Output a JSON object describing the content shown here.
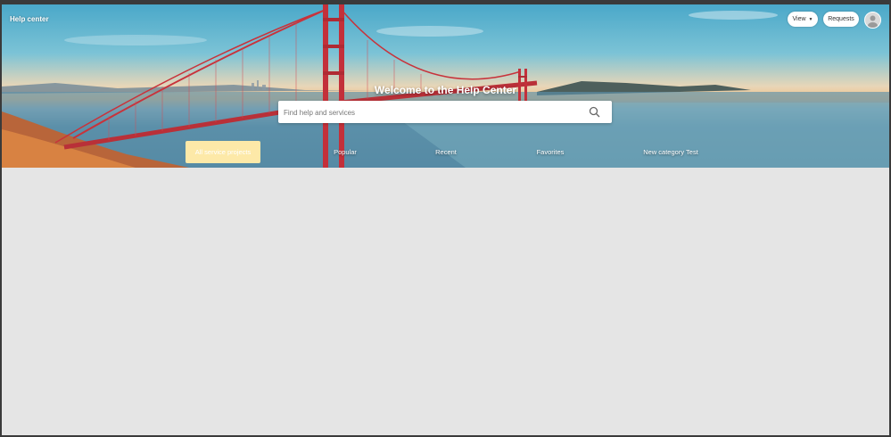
{
  "header": {
    "brand": "Help center",
    "view_label": "View",
    "requests_label": "Requests"
  },
  "hero": {
    "title": "Welcome to the Help Center",
    "search_placeholder": "Find help and services"
  },
  "tabs": [
    {
      "label": "All service projects",
      "active": true
    },
    {
      "label": "Popular",
      "active": false
    },
    {
      "label": "Recent",
      "active": false
    },
    {
      "label": "Favorites",
      "active": false
    },
    {
      "label": "New category Test",
      "active": false
    }
  ],
  "colors": {
    "active_tab": "#fde9a8",
    "content_bg": "#e5e5e5",
    "bridge": "#c8333b"
  },
  "icons": {
    "search": "search-icon",
    "avatar": "user-avatar-icon",
    "caret": "chevron-down-icon"
  }
}
